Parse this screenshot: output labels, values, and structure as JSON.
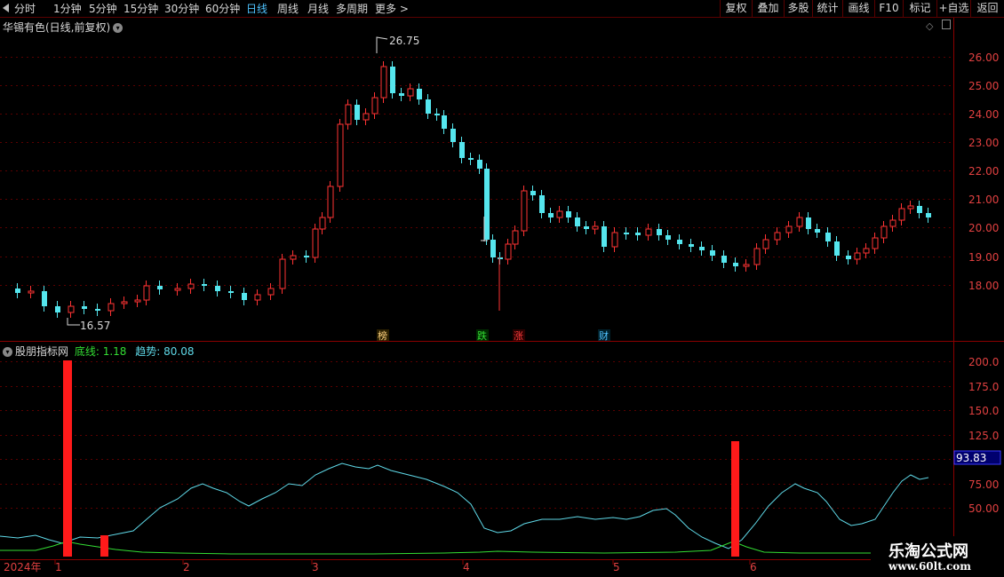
{
  "toolbar": {
    "periods": [
      "分时",
      "1分钟",
      "5分钟",
      "15分钟",
      "30分钟",
      "60分钟",
      "日线",
      "周线",
      "月线",
      "多周期",
      "更多 >"
    ],
    "active_period": "日线",
    "actions": [
      "复权",
      "叠加",
      "多股",
      "统计",
      "画线",
      "F10",
      "标记",
      "+自选",
      "返回"
    ]
  },
  "main_panel": {
    "title": "华锡有色(日线,前复权)",
    "y_ticks": [
      "26.00",
      "25.00",
      "24.00",
      "23.00",
      "22.00",
      "21.00",
      "20.00",
      "19.00",
      "18.00"
    ],
    "high_label": "26.75",
    "low_label": "16.57",
    "event_markers": [
      {
        "text": "榜",
        "color": "#ffd27f"
      },
      {
        "text": "跌",
        "color": "#33dd33"
      },
      {
        "text": "涨",
        "color": "#ff3b3b"
      },
      {
        "text": "财",
        "color": "#4fc3ff"
      }
    ]
  },
  "indicator_panel": {
    "title": "股朋指标网",
    "line1_label": "底线:",
    "line1_value": "1.18",
    "line2_label": "趋势:",
    "line2_value": "80.08",
    "y_ticks": [
      "200.0",
      "175.0",
      "150.0",
      "125.0",
      "75.00",
      "50.00"
    ],
    "current_value": "93.83",
    "colors": {
      "line1": "#33dd33",
      "line2": "#5fd9e8",
      "bar": "#ff1a1a"
    }
  },
  "x_axis": {
    "labels": [
      "2024年",
      "1",
      "2",
      "3",
      "4",
      "5",
      "6"
    ]
  },
  "watermark": {
    "line1": "乐淘公式网",
    "line2": "www.60lt.com"
  }
}
